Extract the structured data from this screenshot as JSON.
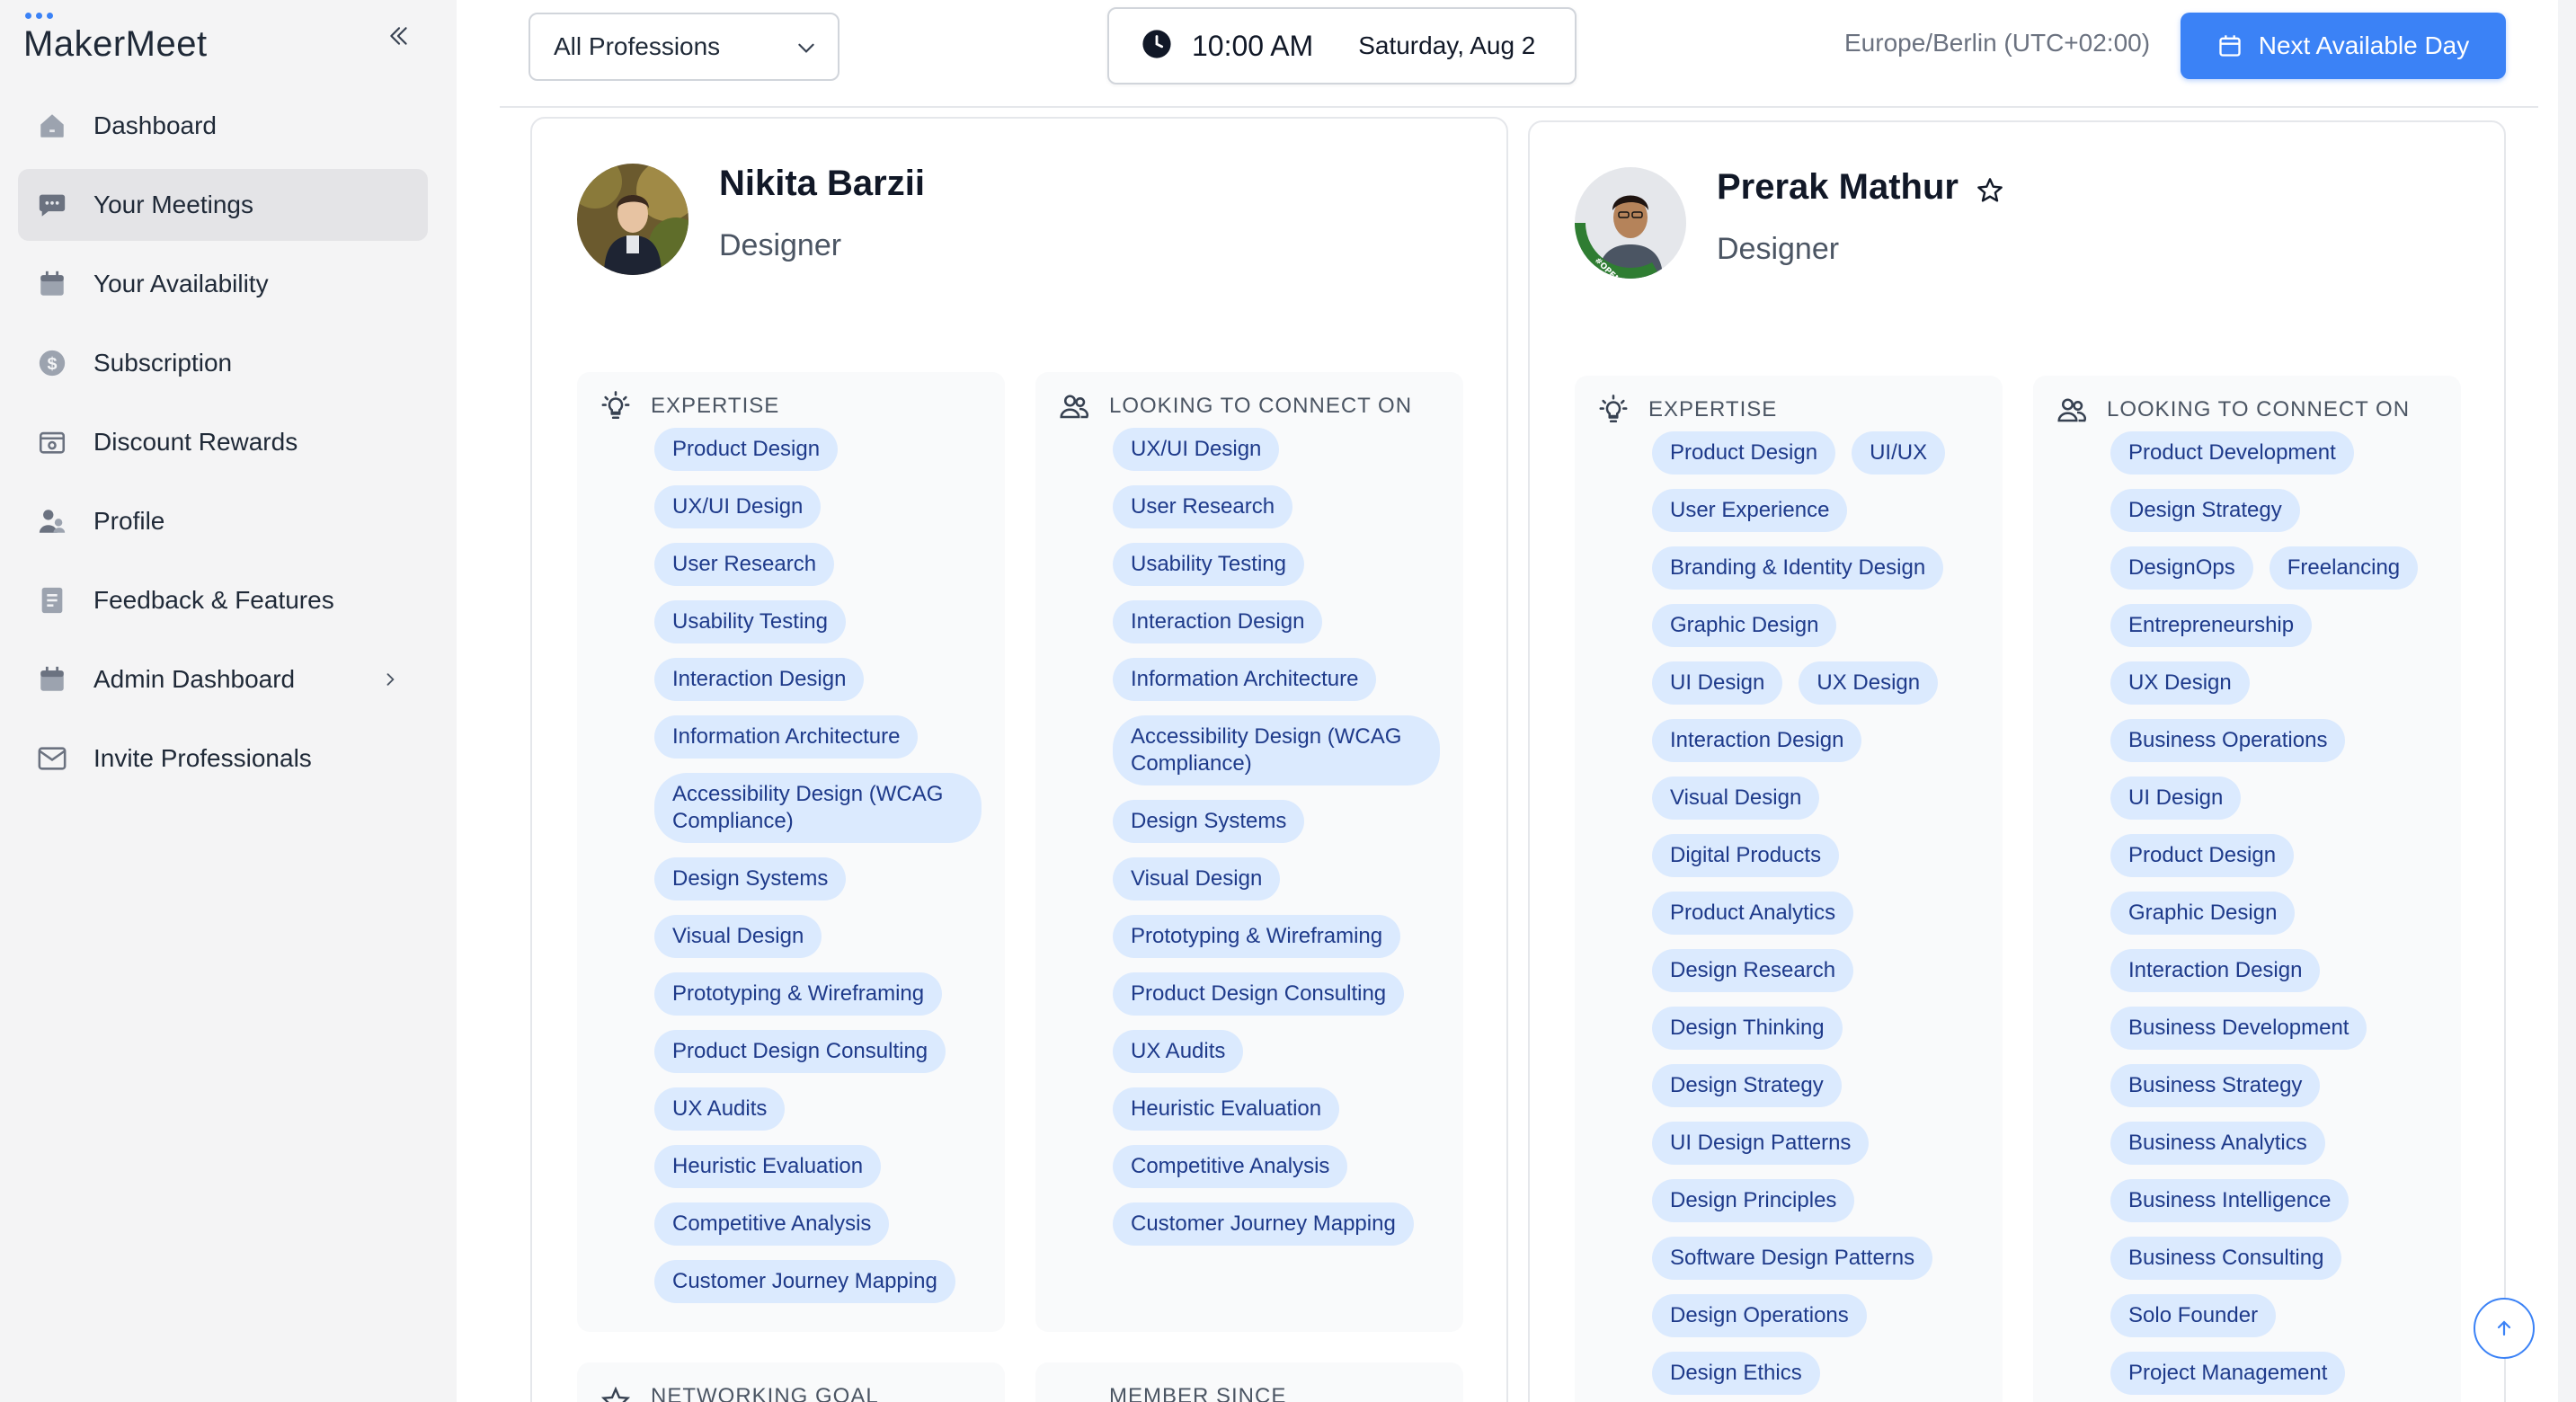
{
  "app": {
    "name": "MakerMeet"
  },
  "sidebar": {
    "items": [
      {
        "label": "Dashboard",
        "icon": "dashboard-icon"
      },
      {
        "label": "Your Meetings",
        "icon": "chat-bubble-icon"
      },
      {
        "label": "Your Availability",
        "icon": "calendar-icon"
      },
      {
        "label": "Subscription",
        "icon": "dollar-coin-icon"
      },
      {
        "label": "Discount Rewards",
        "icon": "voucher-icon"
      },
      {
        "label": "Profile",
        "icon": "user-icon"
      },
      {
        "label": "Feedback & Features",
        "icon": "document-icon"
      },
      {
        "label": "Admin Dashboard",
        "icon": "calendar-icon"
      },
      {
        "label": "Invite Professionals",
        "icon": "envelope-icon"
      }
    ],
    "active": "Your Meetings"
  },
  "topbar": {
    "profession_filter": "All Professions",
    "time": "10:00 AM",
    "date": "Saturday, Aug 2",
    "timezone": "Europe/Berlin (UTC+02:00)",
    "next_button": "Next Available Day"
  },
  "colors": {
    "accent": "#3b82f6",
    "chip_bg": "#dbeafe",
    "chip_text": "#1e3a8a"
  },
  "sections": {
    "expertise": "EXPERTISE",
    "looking": "LOOKING TO CONNECT ON",
    "networking_goal": "NETWORKING GOAL",
    "member_since": "MEMBER SINCE"
  },
  "profiles": [
    {
      "name": "Nikita Barzii",
      "role": "Designer",
      "expertise": [
        "Product Design",
        "UX/UI Design",
        "User Research",
        "Usability Testing",
        "Interaction Design",
        "Information Architecture",
        "Accessibility Design (WCAG Compliance)",
        "Design Systems",
        "Visual Design",
        "Prototyping & Wireframing",
        "Product Design Consulting",
        "UX Audits",
        "Heuristic Evaluation",
        "Competitive Analysis",
        "Customer Journey Mapping"
      ],
      "looking": [
        "UX/UI Design",
        "User Research",
        "Usability Testing",
        "Interaction Design",
        "Information Architecture",
        "Accessibility Design (WCAG Compliance)",
        "Design Systems",
        "Visual Design",
        "Prototyping & Wireframing",
        "Product Design Consulting",
        "UX Audits",
        "Heuristic Evaluation",
        "Competitive Analysis",
        "Customer Journey Mapping"
      ]
    },
    {
      "name": "Prerak Mathur",
      "role": "Designer",
      "expertise": [
        "Product Design",
        "UI/UX",
        "User Experience",
        "Branding & Identity Design",
        "Graphic Design",
        "UI Design",
        "UX Design",
        "Interaction Design",
        "Visual Design",
        "Digital Products",
        "Product Analytics",
        "Design Research",
        "Design Thinking",
        "Design Strategy",
        "UI Design Patterns",
        "Design Principles",
        "Software Design Patterns",
        "Design Operations",
        "Design Ethics"
      ],
      "looking": [
        "Product Development",
        "Design Strategy",
        "DesignOps",
        "Freelancing",
        "Entrepreneurship",
        "UX Design",
        "Business Operations",
        "UI Design",
        "Product Design",
        "Graphic Design",
        "Interaction Design",
        "Business Development",
        "Business Strategy",
        "Business Analytics",
        "Business Intelligence",
        "Business Consulting",
        "Solo Founder",
        "Project Management"
      ]
    }
  ]
}
